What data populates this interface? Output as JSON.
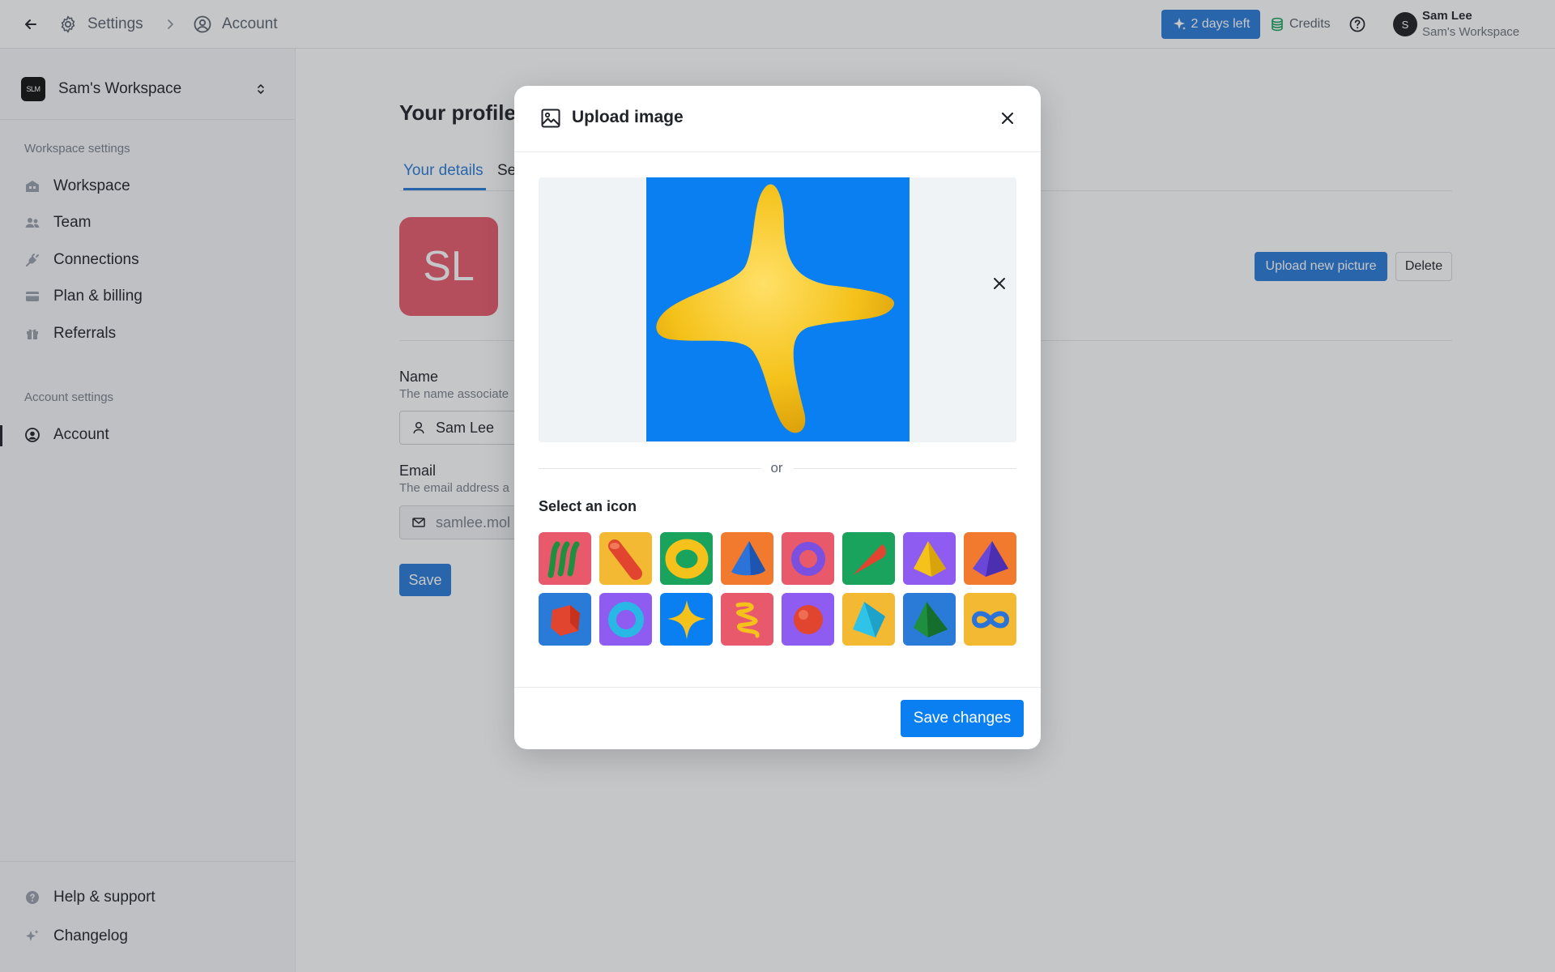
{
  "topbar": {
    "back_icon": "arrow-left-icon",
    "breadcrumb": [
      {
        "icon": "gear-icon",
        "label": "Settings"
      },
      {
        "icon": "user-circle-icon",
        "label": "Account"
      }
    ],
    "trial_label": "2 days left",
    "credits_label": "Credits",
    "help_icon": "question-circle-icon",
    "user": {
      "initial": "S",
      "name": "Sam Lee",
      "workspace": "Sam's Workspace"
    }
  },
  "sidebar": {
    "workspace": {
      "logo_text": "SLM",
      "name": "Sam's Workspace"
    },
    "workspace_heading": "Workspace settings",
    "workspace_items": [
      {
        "icon": "building-icon",
        "label": "Workspace"
      },
      {
        "icon": "users-icon",
        "label": "Team"
      },
      {
        "icon": "plug-icon",
        "label": "Connections"
      },
      {
        "icon": "credit-card-icon",
        "label": "Plan & billing"
      },
      {
        "icon": "gift-icon",
        "label": "Referrals"
      }
    ],
    "account_heading": "Account settings",
    "account_items": [
      {
        "icon": "user-circle-icon",
        "label": "Account",
        "active": true
      }
    ],
    "footer_items": [
      {
        "icon": "question-circle-icon",
        "label": "Help & support"
      },
      {
        "icon": "sparkle-icon",
        "label": "Changelog"
      }
    ]
  },
  "main": {
    "title": "Your profile",
    "tabs": [
      {
        "label": "Your details",
        "active": true
      },
      {
        "label": "Se"
      }
    ],
    "avatar_initials": "SL",
    "avatar_color": "#e85a6b",
    "upload_label": "Upload new picture",
    "delete_label": "Delete",
    "name_label": "Name",
    "name_help": "The name associate",
    "name_value": "Sam Lee",
    "email_label": "Email",
    "email_help": "The email address a",
    "email_value": "samlee.mol",
    "save_label": "Save"
  },
  "modal": {
    "title": "Upload image",
    "image_icon": "image-icon",
    "close_icon": "close-icon",
    "preview_bg": "#0a7ff2",
    "preview_subject": "yellow-star-icon",
    "or_label": "or",
    "select_title": "Select an icon",
    "icons": [
      {
        "name": "green-squiggle-icon",
        "bg": "#e85a6b"
      },
      {
        "name": "red-cylinder-icon",
        "bg": "#f4b933"
      },
      {
        "name": "yellow-torus-icon",
        "bg": "#19a35c"
      },
      {
        "name": "blue-cone-icon",
        "bg": "#f27a2e"
      },
      {
        "name": "purple-ring-icon",
        "bg": "#e85a6b"
      },
      {
        "name": "red-cone-icon",
        "bg": "#19a35c"
      },
      {
        "name": "yellow-pyramid-icon",
        "bg": "#8e5cf0"
      },
      {
        "name": "purple-pyramid-icon",
        "bg": "#f27a2e"
      },
      {
        "name": "red-cube-icon",
        "bg": "#2a7bd8"
      },
      {
        "name": "cyan-ring-icon",
        "bg": "#8e5cf0"
      },
      {
        "name": "yellow-star-icon",
        "bg": "#0a7ff2"
      },
      {
        "name": "yellow-spring-icon",
        "bg": "#e85a6b"
      },
      {
        "name": "red-sphere-icon",
        "bg": "#8e5cf0"
      },
      {
        "name": "cyan-gem-icon",
        "bg": "#f4b933"
      },
      {
        "name": "green-pyramid-icon",
        "bg": "#2a7bd8"
      },
      {
        "name": "blue-infinity-icon",
        "bg": "#f4b933"
      }
    ],
    "save_label": "Save changes"
  },
  "colors": {
    "accent": "#2a7bd8",
    "modal_accent": "#0a7ff2"
  }
}
